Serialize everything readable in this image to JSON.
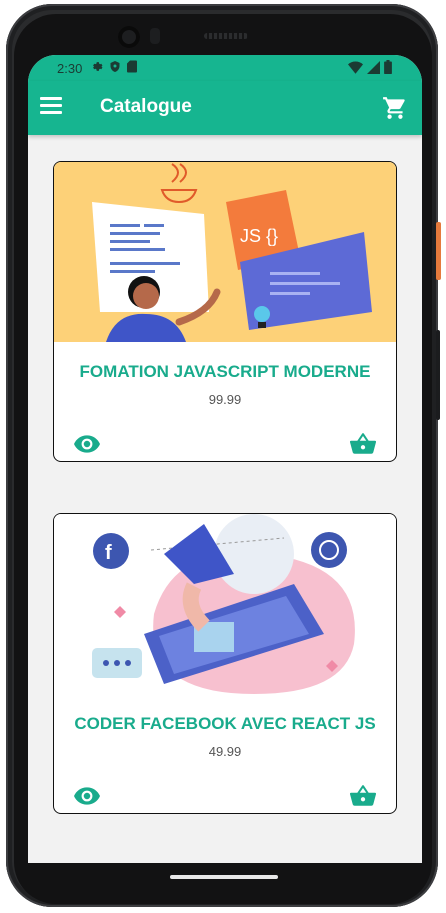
{
  "status_bar": {
    "time": "2:30"
  },
  "app_bar": {
    "title": "Catalogue"
  },
  "colors": {
    "primary": "#16b590",
    "accent_text": "#19ab8c"
  },
  "products": [
    {
      "title": "FOMATION JAVASCRIPT MODERNE",
      "price": "99.99",
      "image_icon": "javascript-illustration",
      "badge": "JS {}"
    },
    {
      "title": "CODER FACEBOOK AVEC REACT JS",
      "price": "49.99",
      "image_icon": "social-media-illustration"
    }
  ]
}
